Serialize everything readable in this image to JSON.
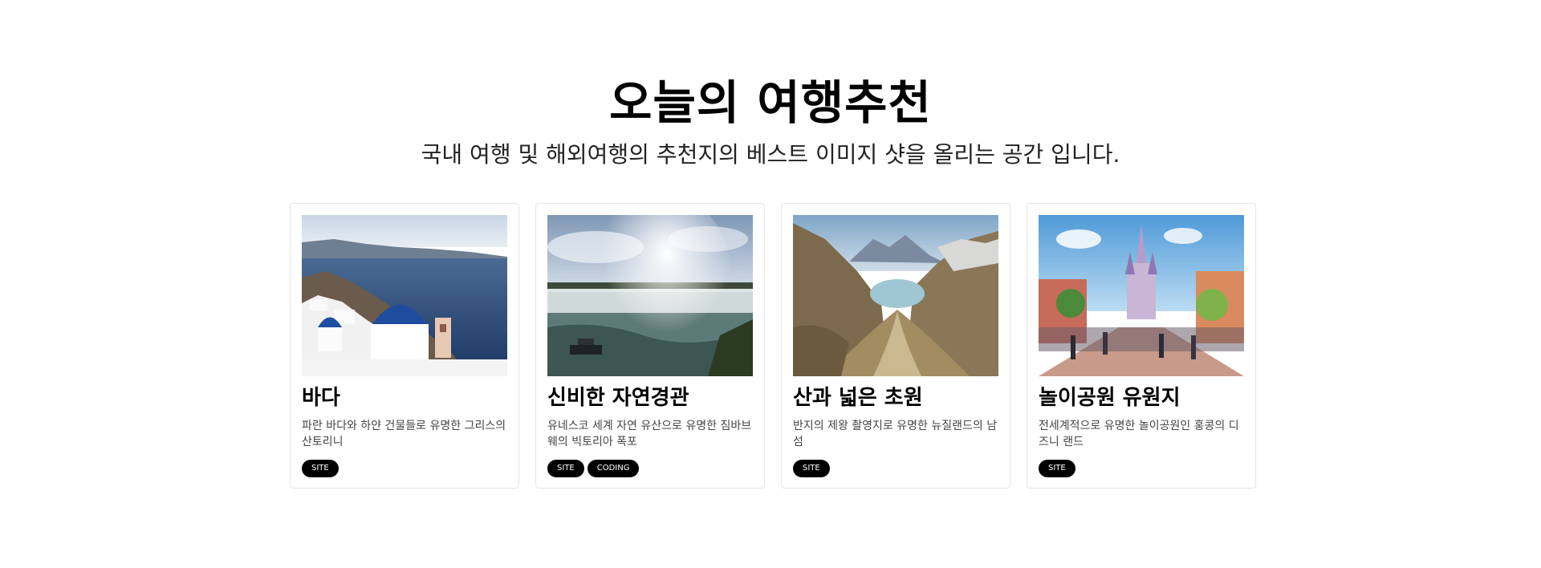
{
  "header": {
    "title": "오늘의 여행추천",
    "subtitle": "국내 여행 및 해외여행의 추천지의 베스트 이미지 샷을 올리는 공간 입니다."
  },
  "cards": [
    {
      "title": "바다",
      "description": "파란 바다와 하얀 건물들로 유명한 그리스의 산토리니",
      "tags": [
        "SITE"
      ]
    },
    {
      "title": "신비한 자연경관",
      "description": "유네스코 세계 자연 유산으로 유명한 짐바브웨의 빅토리아 폭포",
      "tags": [
        "SITE",
        "CODING"
      ]
    },
    {
      "title": "산과 넓은 초원",
      "description": "반지의 제왕 촬영지로 유명한 뉴질랜드의 남 섬",
      "tags": [
        "SITE"
      ]
    },
    {
      "title": "놀이공원 유원지",
      "description": "전세계적으로 유명한 놀이공원인 홍콩의 디즈니 랜드",
      "tags": [
        "SITE"
      ]
    }
  ]
}
